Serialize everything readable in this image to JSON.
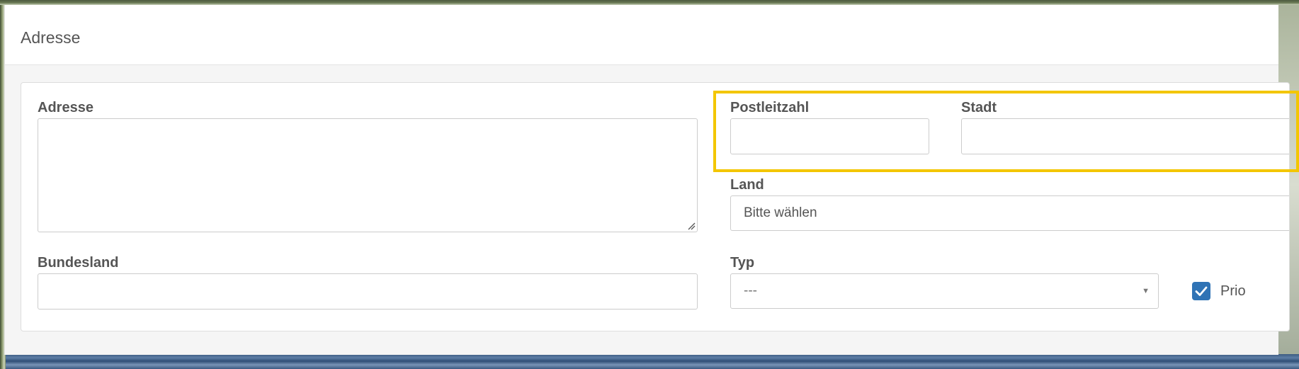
{
  "panel": {
    "title": "Adresse"
  },
  "form": {
    "address": {
      "label": "Adresse",
      "value": ""
    },
    "postal_code": {
      "label": "Postleitzahl",
      "value": ""
    },
    "city": {
      "label": "Stadt",
      "value": ""
    },
    "country": {
      "label": "Land",
      "selected": "Bitte wählen"
    },
    "state": {
      "label": "Bundesland",
      "value": ""
    },
    "type": {
      "label": "Typ",
      "selected": "---"
    },
    "prio": {
      "label": "Prio",
      "checked": true
    }
  },
  "icons": {
    "dropdown": "chevron-down-icon",
    "check": "checkmark-icon",
    "resize": "resize-grip-icon"
  },
  "colors": {
    "highlight": "#f3c600",
    "checkbox": "#2f73b5",
    "label_text": "#555555"
  }
}
